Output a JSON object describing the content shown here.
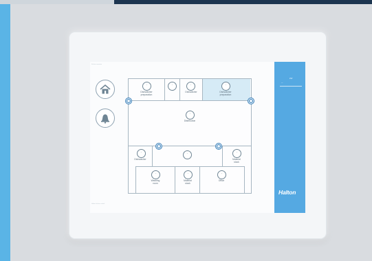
{
  "screen": {
    "caption_top": "Kitchen overview",
    "caption_bottom": "Halton kitchen control"
  },
  "controls": {
    "home": {
      "icon": "home-icon"
    },
    "alarm": {
      "icon": "bell-icon"
    }
  },
  "rooms": [
    {
      "label": "Dishwasher\npreparation",
      "value": "--"
    },
    {
      "label": "",
      "value": "--"
    },
    {
      "label": "Dishwasher",
      "value": "--"
    },
    {
      "label": "Dishwasher",
      "value": "--"
    },
    {
      "label": "Dishwasher\npreparation",
      "value": "--"
    },
    {
      "label": "Distribution",
      "value": "--"
    },
    {
      "label": "Dishwasher",
      "value": "--"
    },
    {
      "label": "",
      "value": "--"
    },
    {
      "label": "Material\nstock",
      "value": "--"
    },
    {
      "label": "Washing\nroom",
      "value": "--"
    },
    {
      "label": "Material\nstock",
      "value": "--"
    },
    {
      "label": "Office",
      "value": "--"
    }
  ],
  "side_panel": {
    "label": "kW",
    "field_value": "—",
    "logo": "Halton",
    "accent": "#55a9e2"
  }
}
